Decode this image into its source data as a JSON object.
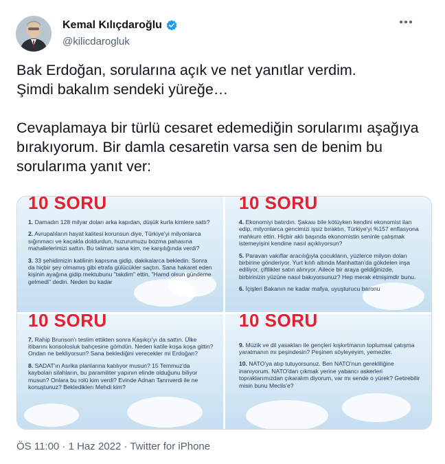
{
  "author": {
    "name": "Kemal Kılıçdaroğlu",
    "handle": "@kilicdarogluk"
  },
  "tweet": {
    "text": "Bak Erdoğan, sorularına açık ve net yanıtlar verdim.\nŞimdi bakalım sendeki yüreğe…\n\nCevaplamaya bir türlü cesaret edemediğin sorularımı aşağıya bırakıyorum. Bir damla cesaretin varsa sen de benim bu sorularıma yanıt ver:",
    "timestamp": "ÖS 11:00 · 1 Haz 2022 · Twitter for iPhone"
  },
  "panels": [
    {
      "title": "10 SORU",
      "questions": [
        {
          "num": "1.",
          "text": "Damadın 128 milyar doları arka kapıdan, düşük kurla kimlere sattı?"
        },
        {
          "num": "2.",
          "text": "Avrupalıların hayat kalitesi korunsun diye, Türkiye'yi milyonlarca sığınmacı ve kaçakla doldurdun, huzurumuzu bozma pahasına mahallelerimizi sattın. Bu talimatı sana kim, ne karşılığında verdi?"
        },
        {
          "num": "3.",
          "text": "33 şehidimizin katilinin kapısına gidip, dakikalarca bekledin. Sonra da hiçbir şey olmamış gibi etrafa gülücükler saçtın. Sana hakaret eden kişinin ayağına gidip mektubunu \"takdim\" ettin, \"Hamd olsun gündeme gelmedi\" dedin. Neden bu kadar"
        }
      ]
    },
    {
      "title": "10 SORU",
      "questions": [
        {
          "num": "4.",
          "text": "Ekonomiyi batırdın. Şakası bile kötüyken kendini ekonomist ilan edip, milyonlarca gencimizi işsiz bıraktın, Türkiye'yi %157 enflasyona mahkum ettin. Hiçbir aklı başında ekonomistin seninle çalışmak istemeyişini kendine nasıl açıklıyorsun?"
        },
        {
          "num": "5.",
          "text": "Paravan vakıflar aracılığıyla çocukların, yüzlerce milyon doları birbirine gönderiyor. Yurt kılıfı altında Manhattan'da gökdelen inşa ediliyor, çiftlikler satın alınıyor. Ailece bir araya geldiğinizde, birbirinizin yüzüne nasıl bakıyorsunuz? Hep merak etmişimdir bunu."
        },
        {
          "num": "6.",
          "text": "İçişleri Bakanın ne kadar mafya, uyuşturucu baronu"
        }
      ]
    },
    {
      "title": "10 SORU",
      "questions": [
        {
          "num": "7.",
          "text": "Rahip Brunson'ı teslim ettikten sonra Kaşıkçı'yı da sattın. Ülke itibarını konsolosluk bahçesine gömdün. Neden katile koşa koşa gittin? Ondan ne bekliyorsun? Sana beklediğini verecekler mi Erdoğan?"
        },
        {
          "num": "8.",
          "text": "SADAT'ın Asrika planlarına katılıyor musun? 15 Temmuz'da kaybolan silahların, bu paramiliter yapının elinde olduğunu biliyor musun? Onlara bu rolü kim verdi? Evinde Adnan Tanrıverdi ile ne konuştunuz? Beklediklerı Mehdi kim?"
        }
      ]
    },
    {
      "title": "10 SORU",
      "questions": [
        {
          "num": "9.",
          "text": "Müzik ve dil yasakları ile gençleri kışkırtmanın toplumsal çatışma yaratmanın mı peşindesin? Peşinen söyleyeyim, yemezler."
        },
        {
          "num": "10.",
          "text": "NATO'ya atıp tutuyorsunuz. Ben NATO'nun gerekliliğine inanıyorum. NATO'dan çıkmak yerine yabancı askerleri topraklarımızdan çıkaralım diyorum, var mı sende o yürek? Getirebilir misin bunu Meclis'e?"
        }
      ]
    }
  ],
  "icons": {
    "verified": "verified-badge-icon",
    "more": "more-options-icon"
  },
  "colors": {
    "accent": "#1d9bf0",
    "panel_title": "#e5202e",
    "muted": "#536471"
  }
}
